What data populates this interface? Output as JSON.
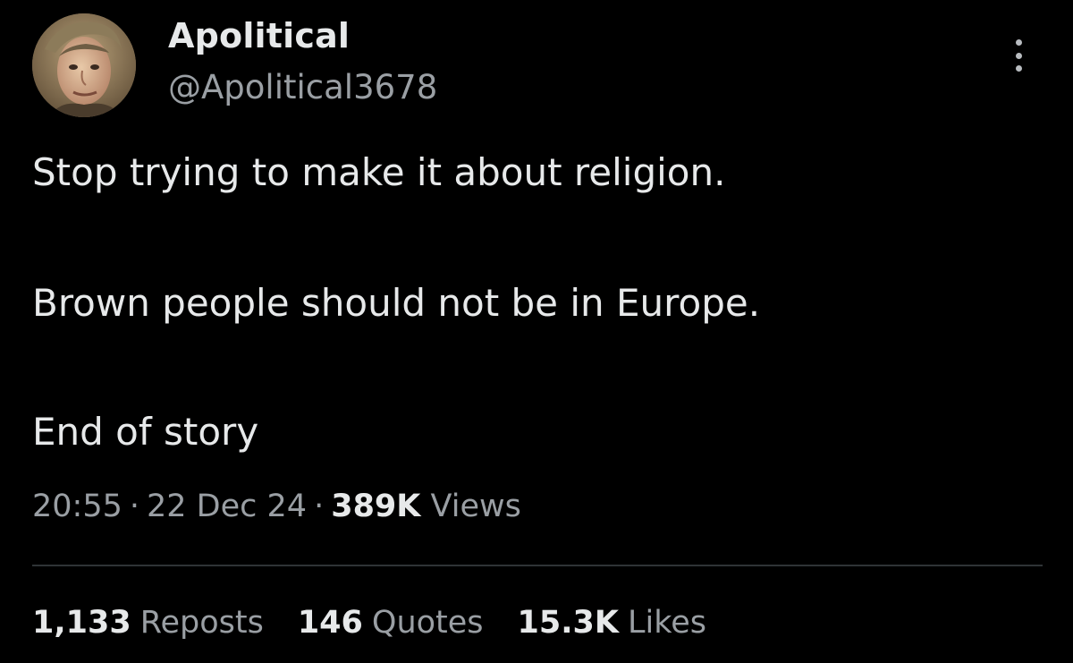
{
  "author": {
    "display_name": "Apolitical",
    "handle": "@Apolitical3678",
    "avatar_icon": "portrait-avatar"
  },
  "more_icon": "more-vertical-icon",
  "tweet": {
    "lines": [
      "Stop trying to make it about religion.",
      "Brown people should not be in Europe.",
      "End of story"
    ]
  },
  "meta": {
    "time": "20:55",
    "separator": "·",
    "date": "22 Dec 24",
    "views_count": "389K",
    "views_label": "Views"
  },
  "stats": {
    "reposts_count": "1,133",
    "reposts_label": "Reposts",
    "quotes_count": "146",
    "quotes_label": "Quotes",
    "likes_count": "15.3K",
    "likes_label": "Likes"
  },
  "colors": {
    "background": "#000000",
    "primary_text": "#e7e9ea",
    "secondary_text": "#9a9fa4",
    "divider": "#2f3336"
  }
}
